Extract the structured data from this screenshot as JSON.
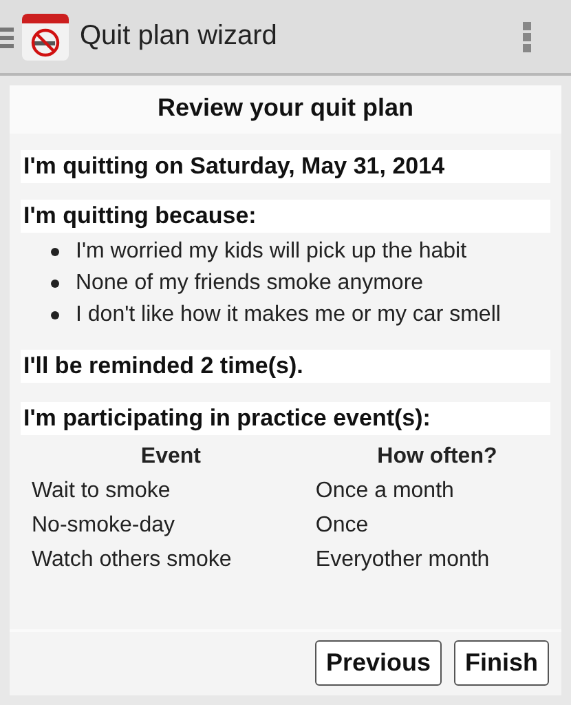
{
  "app_bar": {
    "title": "Quit plan wizard"
  },
  "card": {
    "title": "Review your quit plan",
    "quit_date": "I'm quitting on Saturday, May 31, 2014",
    "reasons_heading": "I'm quitting because:",
    "reasons": [
      "I'm worried my kids will pick up the habit",
      "None of my friends smoke anymore",
      "I don't like how it makes me or my car smell"
    ],
    "reminders": "I'll be reminded 2 time(s).",
    "events_heading": "I'm participating in practice event(s):",
    "table": {
      "columns": [
        "Event",
        "How often?"
      ],
      "rows": [
        [
          "Wait to smoke",
          "Once a month"
        ],
        [
          "No-smoke-day",
          "Once"
        ],
        [
          "Watch others smoke",
          "Everyother month"
        ]
      ]
    }
  },
  "buttons": [
    "Previous",
    "Finish"
  ]
}
